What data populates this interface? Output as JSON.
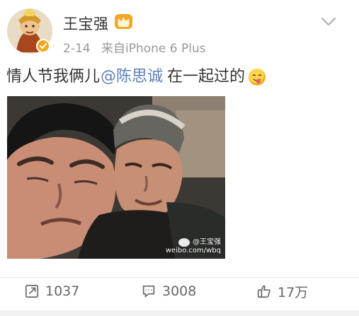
{
  "post": {
    "author": "王宝强",
    "date": "2-14",
    "source": "来自iPhone 6 Plus",
    "text_before": "情人节我俩儿",
    "mention": "@陈思诚",
    "text_after": "在一起过的",
    "image_watermark": {
      "name": "@王宝强",
      "url": "weibo.com/wbq"
    }
  },
  "actions": {
    "repost_count": "1037",
    "comment_count": "3008",
    "like_count": "17万"
  },
  "icons": {
    "avatar": "profile-avatar",
    "verified": "verified-badge-icon",
    "vip": "crown-icon",
    "menu": "chevron-down-icon",
    "emoji": "tongue-out-emoji-icon",
    "repost": "repost-icon",
    "comment": "comment-icon",
    "like": "thumbs-up-icon"
  },
  "colors": {
    "mention": "#5b7fb5",
    "verified": "#f5a623",
    "crown": "#f5a623",
    "muted_text": "#999999",
    "action_text": "#666666"
  }
}
